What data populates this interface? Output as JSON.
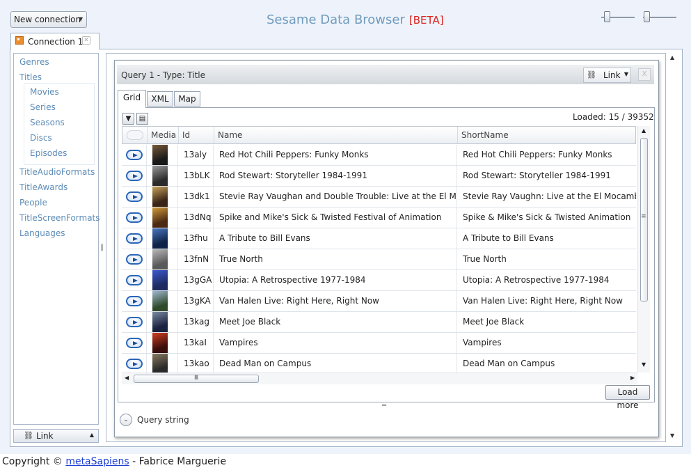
{
  "header": {
    "new_connection_label": "New connection",
    "app_title": "Sesame Data Browser",
    "beta_label": "[BETA]"
  },
  "connection_tab": {
    "label": "Connection 1"
  },
  "left_nav": {
    "items": [
      "Genres",
      "Titles"
    ],
    "title_subitems": [
      "Movies",
      "Series",
      "Seasons",
      "Discs",
      "Episodes"
    ],
    "more_items": [
      "TitleAudioFormats",
      "TitleAwards",
      "People",
      "TitleScreenFormats",
      "Languages"
    ],
    "link_label": "Link"
  },
  "query_panel": {
    "title": "Query 1 - Type: Title",
    "link_label": "Link",
    "tabs": [
      "Grid",
      "XML",
      "Map"
    ],
    "active_tab": "Grid",
    "loaded_text": "Loaded: 15 / 39352",
    "columns": [
      "Media",
      "Id",
      "Name",
      "ShortName"
    ],
    "rows": [
      {
        "id": "13aly",
        "name": "Red Hot Chili Peppers: Funky Monks",
        "short": "Red Hot Chili Peppers: Funky Monks"
      },
      {
        "id": "13bLK",
        "name": "Rod Stewart: Storyteller 1984-1991",
        "short": "Rod Stewart: Storyteller 1984-1991"
      },
      {
        "id": "13dk1",
        "name": "Stevie Ray Vaughan and Double Trouble: Live at the El Moca",
        "short": "Stevie Ray Vaughn: Live at the El Mocambo"
      },
      {
        "id": "13dNq",
        "name": "Spike and Mike's Sick & Twisted Festival of Animation",
        "short": "Spike & Mike's Sick & Twisted Animation"
      },
      {
        "id": "13fhu",
        "name": "A Tribute to Bill Evans",
        "short": "A Tribute to Bill Evans"
      },
      {
        "id": "13fnN",
        "name": "True North",
        "short": "True North"
      },
      {
        "id": "13gGA",
        "name": "Utopia: A Retrospective 1977-1984",
        "short": "Utopia: A Retrospective 1977-1984"
      },
      {
        "id": "13gKA",
        "name": "Van Halen Live: Right Here, Right Now",
        "short": "Van Halen Live: Right Here, Right Now"
      },
      {
        "id": "13kag",
        "name": "Meet Joe Black",
        "short": "Meet Joe Black"
      },
      {
        "id": "13kaI",
        "name": "Vampires",
        "short": "Vampires"
      },
      {
        "id": "13kao",
        "name": "Dead Man on Campus",
        "short": "Dead Man on Campus"
      }
    ],
    "load_more_label": "Load more",
    "query_string_label": "Query string"
  },
  "footer": {
    "prefix": "Copyright ©",
    "link_text": "metaSapiens",
    "suffix": "- Fabrice Marguerie"
  },
  "icons": {
    "dropdown": "caret-down-icon",
    "connection": "database-icon",
    "link": "chain-link-icon",
    "filter": "filter-icon",
    "columns": "columns-icon",
    "open_row": "arrow-right-icon",
    "expand": "chevron-down-icon"
  },
  "colors": {
    "title": "#6f9bbd",
    "beta": "#d9231d",
    "nav_link": "#5d8cb7",
    "row_icon": "#2a66b6",
    "footer_link": "#1e3fd6"
  }
}
